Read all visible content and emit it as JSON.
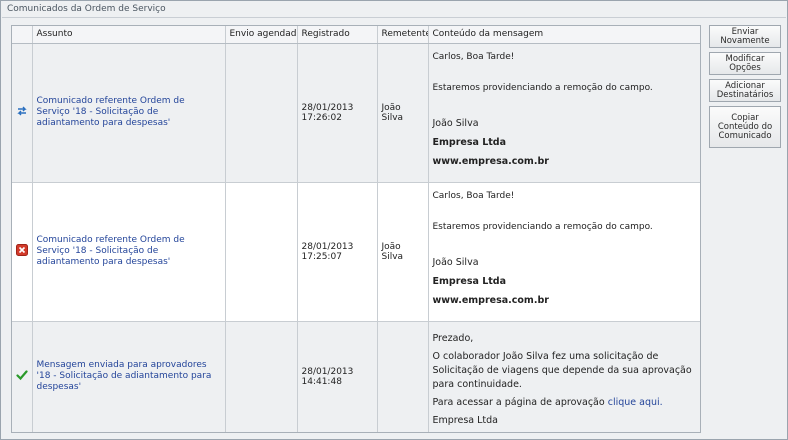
{
  "panel": {
    "title": "Comunicados da Ordem de Serviço"
  },
  "table": {
    "headers": [
      "Assunto",
      "Envio agendado",
      "Registrado",
      "Remetente",
      "Conteúdo da mensagem"
    ]
  },
  "rows": [
    {
      "status_icon": "pending-arrows-icon",
      "subject": "Comunicado referente Ordem de Serviço '18 - Solicitação de adiantamento para despesas'",
      "scheduled": "",
      "registered_date": "28/01/2013",
      "registered_time": "17:26:02",
      "sender": "João Silva",
      "message": {
        "greeting": "Carlos, Boa Tarde!",
        "body": "Estaremos providenciando a remoção do campo.",
        "sign_name": "João Silva",
        "sign_company": "Empresa Ltda",
        "sign_site": "www.empresa.com.br"
      }
    },
    {
      "status_icon": "error-x-icon",
      "subject": "Comunicado referente Ordem de Serviço '18 - Solicitação de adiantamento para despesas'",
      "scheduled": "",
      "registered_date": "28/01/2013",
      "registered_time": "17:25:07",
      "sender": "João Silva",
      "message": {
        "greeting": "Carlos, Boa Tarde!",
        "body": "Estaremos providenciando a remoção do campo.",
        "sign_name": "João Silva",
        "sign_company": "Empresa Ltda",
        "sign_site": "www.empresa.com.br"
      }
    },
    {
      "status_icon": "success-check-icon",
      "subject": "Mensagem enviada para aprovadores '18 - Solicitação de adiantamento para despesas'",
      "scheduled": "",
      "registered_date": "28/01/2013",
      "registered_time": "14:41:48",
      "sender": "",
      "message": {
        "greeting": "Prezado,",
        "body": "O colaborador João Silva fez uma solicitação de Solicitação de viagens que depende da sua aprovação para continuidade.",
        "link_prefix": "Para acessar a página de aprovação",
        "link_text": "clique aqui.",
        "sign_company": "Empresa Ltda"
      }
    }
  ],
  "sidebar": {
    "resend": "Enviar Novamente",
    "modify": "Modificar Opções",
    "add_recipients": "Adicionar Destinatários",
    "copy_content": "Copiar Conteúdo do Comunicado"
  },
  "colors": {
    "link": "#24459a",
    "error": "#d23a2a",
    "success": "#2a9a2a",
    "pending": "#2a6fbf"
  }
}
